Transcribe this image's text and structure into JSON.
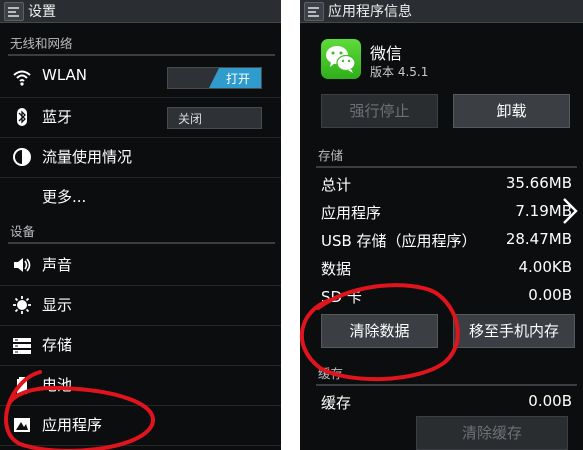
{
  "left": {
    "title": "设置",
    "sections": [
      "无线和网络",
      "设备"
    ],
    "wlan": {
      "label": "WLAN",
      "toggle": "打开"
    },
    "bluetooth": {
      "label": "蓝牙",
      "toggle": "关闭"
    },
    "data_usage": {
      "label": "流量使用情况"
    },
    "more": {
      "label": "更多..."
    },
    "sound": {
      "label": "声音"
    },
    "display": {
      "label": "显示"
    },
    "storage": {
      "label": "存储"
    },
    "battery": {
      "label": "电池"
    },
    "apps": {
      "label": "应用程序"
    }
  },
  "right": {
    "title": "应用程序信息",
    "app_name": "微信",
    "app_version": "版本 4.5.1",
    "force_stop": "强行停止",
    "uninstall": "卸载",
    "storage_header": "存储",
    "rows": [
      {
        "k": "总计",
        "v": "35.66MB"
      },
      {
        "k": "应用程序",
        "v": "7.19MB"
      },
      {
        "k": "USB 存储（应用程序）",
        "v": "28.47MB"
      },
      {
        "k": "数据",
        "v": "4.00KB"
      },
      {
        "k": "SD 卡",
        "v": "0.00B"
      }
    ],
    "clear_data": "清除数据",
    "move_to_phone": "移至手机内存",
    "cache_header": "缓存",
    "cache_row": {
      "k": "缓存",
      "v": "0.00B"
    },
    "clear_cache": "清除缓存"
  },
  "colors": {
    "toggle_on": "#2f9ccd",
    "annotation": "#e0141c",
    "wechat_green": "#44c427"
  }
}
